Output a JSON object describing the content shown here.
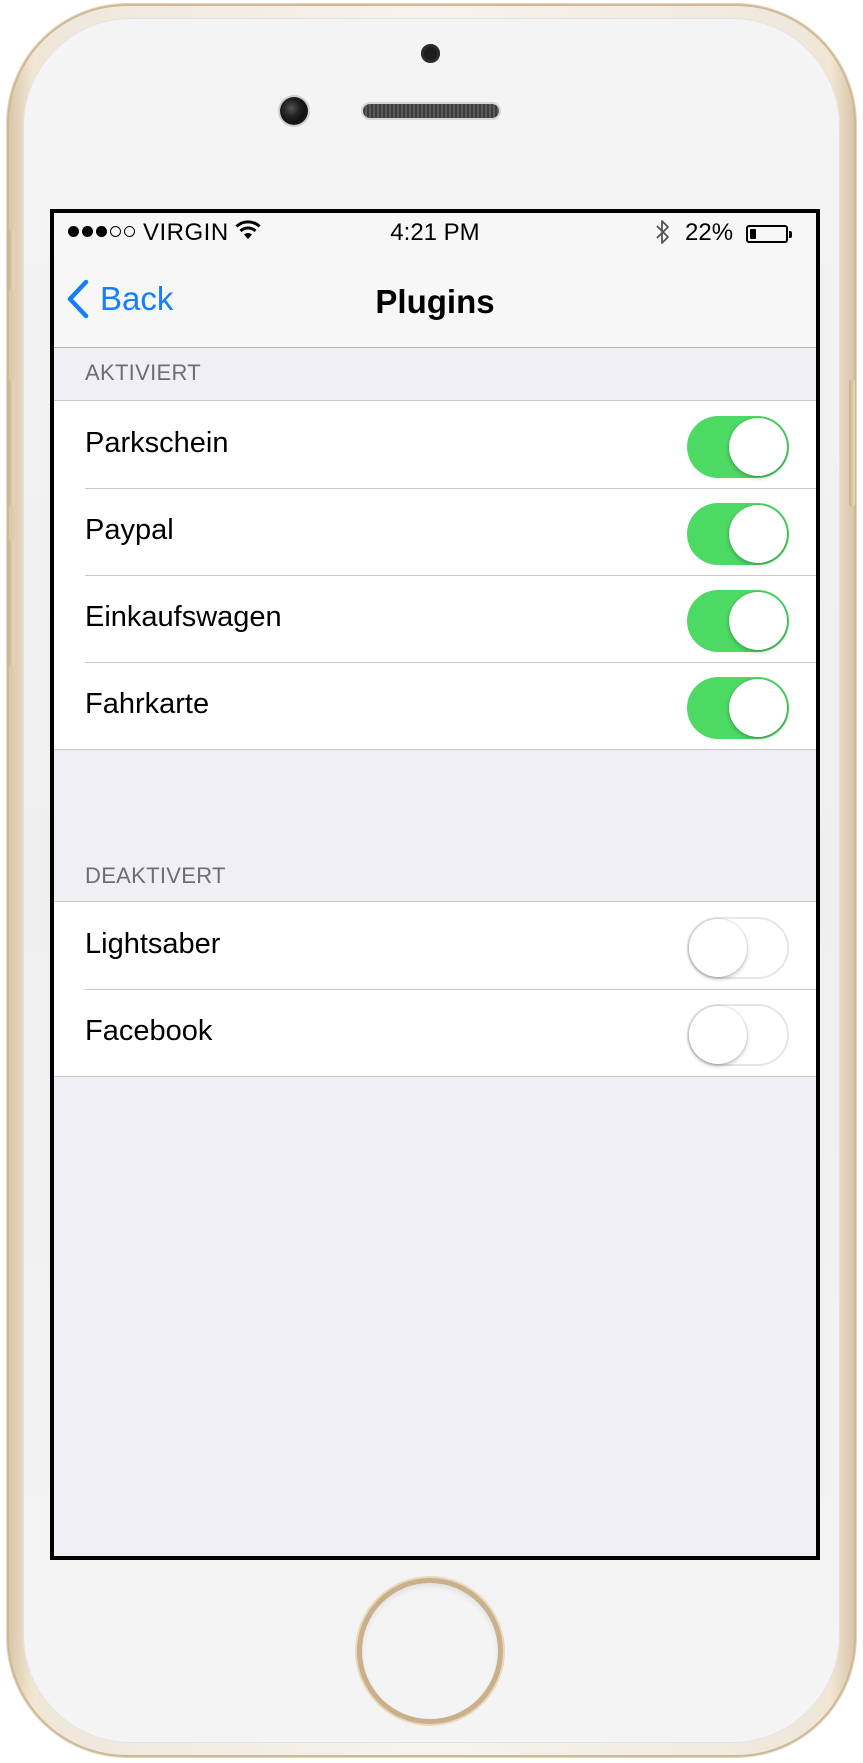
{
  "status_bar": {
    "carrier": "VIRGIN",
    "time": "4:21 PM",
    "battery_percent": "22%",
    "signal_bars_filled": 3,
    "signal_bars_total": 5,
    "battery_level": 0.22
  },
  "nav": {
    "back_label": "Back",
    "title": "Plugins"
  },
  "sections": [
    {
      "header": "AKTIVIERT",
      "items": [
        {
          "label": "Parkschein",
          "enabled": true
        },
        {
          "label": "Paypal",
          "enabled": true
        },
        {
          "label": "Einkaufswagen",
          "enabled": true
        },
        {
          "label": "Fahrkarte",
          "enabled": true
        }
      ]
    },
    {
      "header": "DEAKTIVERT",
      "items": [
        {
          "label": "Lightsaber",
          "enabled": false
        },
        {
          "label": "Facebook",
          "enabled": false
        }
      ]
    }
  ],
  "colors": {
    "accent": "#157efb",
    "toggle_on": "#4cd964",
    "grouped_background": "#efeff4",
    "section_header_text": "#6d6d72"
  }
}
